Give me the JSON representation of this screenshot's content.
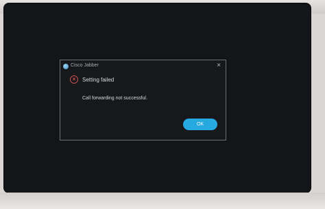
{
  "dialog": {
    "app_title": "Cisco Jabber",
    "close_glyph": "×",
    "error_glyph": "×",
    "heading": "Setting failed",
    "message": "Call forwarding not successful.",
    "ok_label": "OK",
    "icons": {
      "app": "cisco-jabber-icon",
      "status": "error-icon",
      "close": "close-icon"
    },
    "colors": {
      "accent": "#26a9e1",
      "error": "#c8514f",
      "background": "#17181c"
    }
  }
}
